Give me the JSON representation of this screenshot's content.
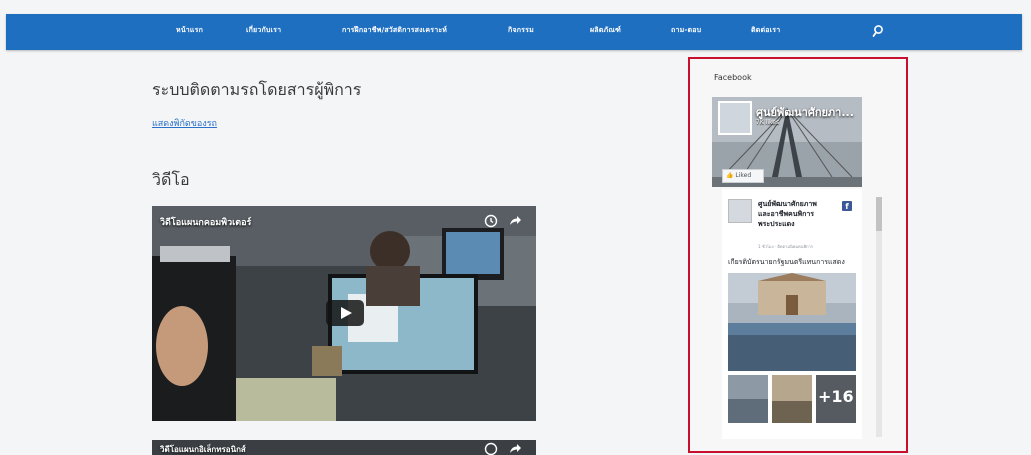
{
  "nav": {
    "items": [
      {
        "label": "หน้าแรก"
      },
      {
        "label": "เกี่ยวกับเรา"
      },
      {
        "label": "การฝึกอาชีพ/สวัสดิการสงเคราะห์"
      },
      {
        "label": "กิจกรรม"
      },
      {
        "label": "ผลิตภัณฑ์"
      },
      {
        "label": "ถาม-ตอบ"
      },
      {
        "label": "ติดต่อเรา"
      }
    ],
    "search_icon": "search-icon"
  },
  "main": {
    "page_title": "ระบบติดตามรถโดยสารผู้พิการ",
    "map_link": "แสดงพิกัดของรถ",
    "video_section_title": "วิดีโอ",
    "videos": [
      {
        "title": "วิดีโอแผนกคอมพิวเตอร์"
      },
      {
        "title": "วิดีโอแผนกอิเล็กทรอนิกส์"
      }
    ]
  },
  "sidebar": {
    "widget_title": "Facebook",
    "page_name": "ศูนย์พัฒนาศักยภา...",
    "likes": "7K likes",
    "liked_button": "Liked",
    "post": {
      "author": "ศูนย์พัฒนาศักยภาพและอาชีพคนพิการพระประแดง",
      "meta": "1 ชั่วโมง · ติดตามนิคมคนพิการ",
      "text": "เกียรติบัตรนายกรัฐมนตรีแทนการแสดง",
      "more_photos": "+16"
    }
  },
  "colors": {
    "nav_bg": "#1f6fc1",
    "highlight_border": "#c8102e",
    "link": "#2a6fc9",
    "facebook_blue": "#3b5998"
  }
}
